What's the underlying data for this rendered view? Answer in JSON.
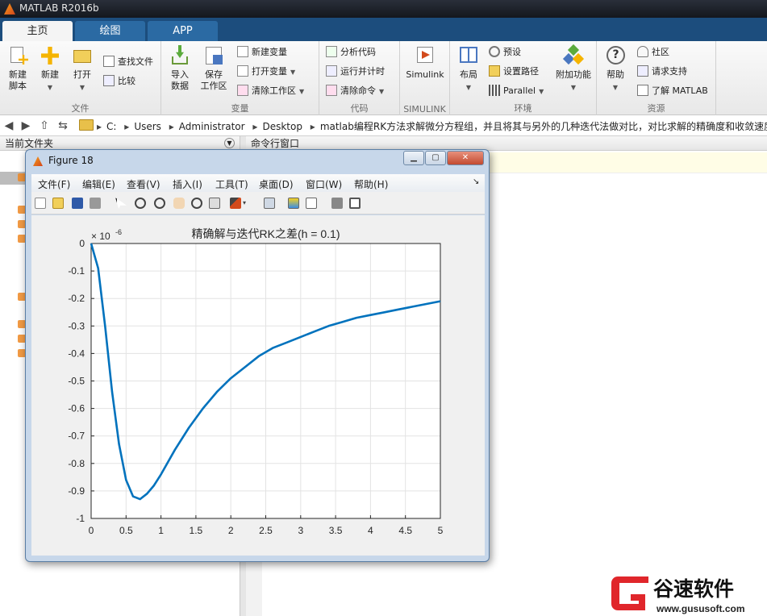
{
  "app": {
    "title": "MATLAB R2016b"
  },
  "tabs": [
    "主页",
    "绘图",
    "APP"
  ],
  "ribbon": {
    "file": {
      "label": "文件",
      "new_script": "新建\n脚本",
      "new": "新建",
      "open": "打开",
      "find_files": "查找文件",
      "compare": "比较"
    },
    "variable": {
      "label": "变量",
      "import": "导入\n数据",
      "save_ws": "保存\n工作区",
      "new_var": "新建变量",
      "open_var": "打开变量",
      "clear_ws": "清除工作区"
    },
    "code": {
      "label": "代码",
      "analyze": "分析代码",
      "run_time": "运行并计时",
      "clear_cmd": "清除命令"
    },
    "simulink": {
      "label": "SIMULINK",
      "button": "Simulink"
    },
    "env": {
      "label": "环境",
      "layout": "布局",
      "prefs": "预设",
      "set_path": "设置路径",
      "parallel": "Parallel",
      "addons": "附加功能"
    },
    "resources": {
      "label": "资源",
      "help": "帮助",
      "community": "社区",
      "support": "请求支持",
      "learn": "了解 MATLAB"
    }
  },
  "address": {
    "crumbs": [
      "C:",
      "Users",
      "Administrator",
      "Desktop",
      "matlab编程RK方法求解微分方程组，并且将其与另外的几种迭代法做对比，对比求解的精确度和收敛速度"
    ]
  },
  "panels": {
    "current_folder": "当前文件夹",
    "command_window": "命令行窗口"
  },
  "figure": {
    "title": "Figure 18",
    "menus": [
      "文件(F)",
      "编辑(E)",
      "查看(V)",
      "插入(I)",
      "工具(T)",
      "桌面(D)",
      "窗口(W)",
      "帮助(H)"
    ]
  },
  "chart_data": {
    "type": "line",
    "title": "精确解与迭代RK之差(h = 0.1)",
    "exponent_label": "× 10",
    "exponent": "-6",
    "xlim": [
      0,
      5
    ],
    "ylim": [
      -1,
      0
    ],
    "xticks": [
      "0",
      "0.5",
      "1",
      "1.5",
      "2",
      "2.5",
      "3",
      "3.5",
      "4",
      "4.5",
      "5"
    ],
    "yticks": [
      "0",
      "-0.1",
      "-0.2",
      "-0.3",
      "-0.4",
      "-0.5",
      "-0.6",
      "-0.7",
      "-0.8",
      "-0.9",
      "-1"
    ],
    "grid": true,
    "color": "#0072BD",
    "x": [
      0,
      0.1,
      0.2,
      0.3,
      0.4,
      0.5,
      0.6,
      0.7,
      0.8,
      0.9,
      1.0,
      1.2,
      1.4,
      1.6,
      1.8,
      2.0,
      2.2,
      2.4,
      2.6,
      2.8,
      3.0,
      3.2,
      3.4,
      3.6,
      3.8,
      4.0,
      4.2,
      4.4,
      4.6,
      4.8,
      5.0
    ],
    "y": [
      0,
      -0.09,
      -0.3,
      -0.54,
      -0.73,
      -0.86,
      -0.92,
      -0.93,
      -0.91,
      -0.88,
      -0.84,
      -0.75,
      -0.67,
      -0.6,
      -0.54,
      -0.49,
      -0.45,
      -0.41,
      -0.38,
      -0.36,
      -0.34,
      -0.32,
      -0.3,
      -0.285,
      -0.27,
      -0.26,
      -0.25,
      -0.24,
      -0.23,
      -0.22,
      -0.21
    ]
  },
  "watermark": {
    "text": "谷速软件",
    "url": "www.gususoft.com"
  }
}
